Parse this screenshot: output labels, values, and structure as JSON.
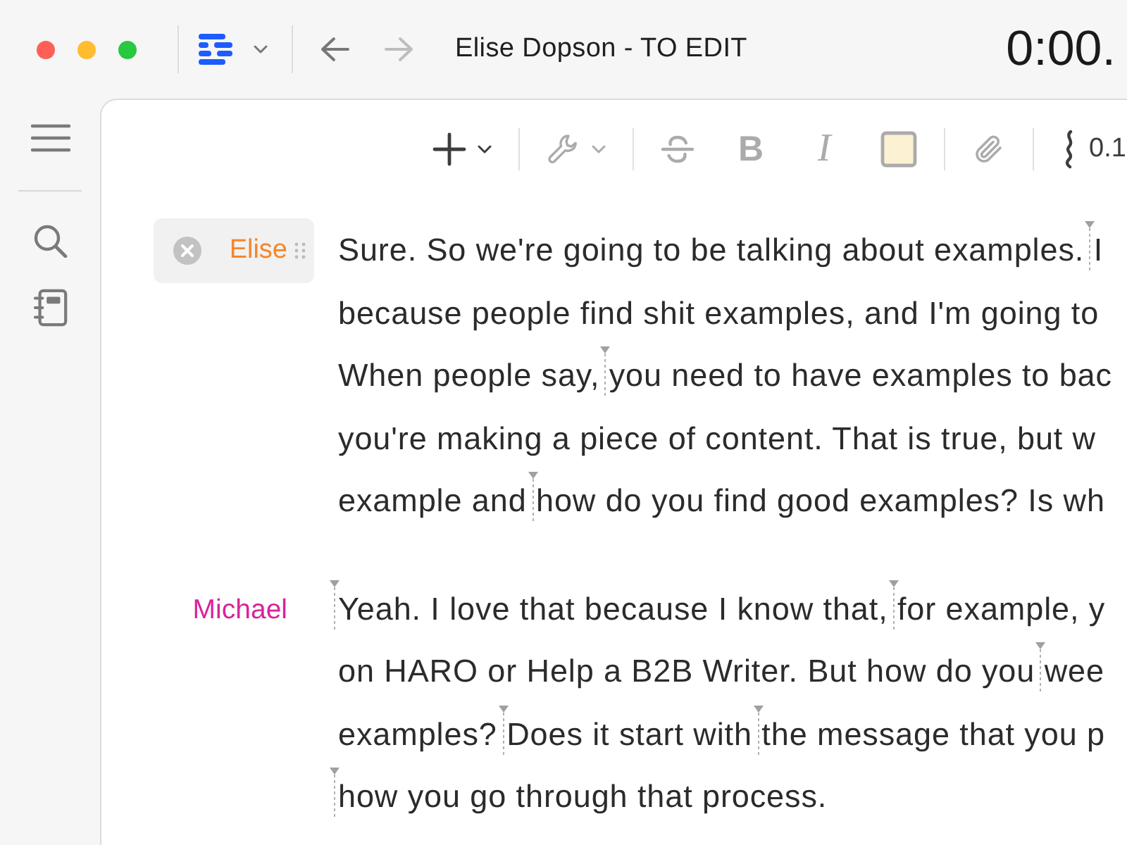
{
  "window": {
    "title": "Elise Dopson - TO EDIT",
    "timer": "0:00."
  },
  "nav": [
    {
      "kind": "back",
      "disabled": false
    },
    {
      "kind": "forward",
      "disabled": true
    }
  ],
  "sidebar": {
    "groups": [
      [
        {
          "kind": "menu"
        }
      ],
      [
        {
          "kind": "search"
        },
        {
          "kind": "notebook"
        }
      ]
    ]
  },
  "toolbar": {
    "groups": [
      [
        {
          "kind": "insert",
          "menu": true,
          "disabled": false
        }
      ],
      [
        {
          "kind": "actions",
          "menu": true,
          "disabled": true
        }
      ],
      [
        {
          "kind": "strikethrough",
          "disabled": true
        },
        {
          "kind": "bold",
          "label": "B",
          "disabled": true
        },
        {
          "kind": "italic",
          "label": "I",
          "disabled": true
        },
        {
          "kind": "highlight",
          "disabled": true
        }
      ],
      [
        {
          "kind": "attach",
          "disabled": true
        }
      ],
      [
        {
          "kind": "gap",
          "label": "0.1",
          "disabled": false
        }
      ]
    ]
  },
  "transcript": [
    {
      "speaker": "Elise",
      "color": "#f5862a",
      "selected": true,
      "lines": [
        {
          "segments": [
            {
              "text": "Sure. So we're going to be talking about examples. ",
              "marker": false
            },
            {
              "text": "I",
              "marker": true
            }
          ]
        },
        {
          "segments": [
            {
              "text": "because people find shit examples, and I'm going to",
              "marker": false
            }
          ]
        },
        {
          "segments": [
            {
              "text": "When people say, ",
              "marker": false
            },
            {
              "text": "you need to have examples to bac",
              "marker": true
            }
          ]
        },
        {
          "segments": [
            {
              "text": "you're making a piece of content. That is true, but w",
              "marker": false
            }
          ]
        },
        {
          "segments": [
            {
              "text": "example and ",
              "marker": false
            },
            {
              "text": "how do you find good examples? Is wh",
              "marker": true
            }
          ]
        }
      ]
    },
    {
      "speaker": "Michael",
      "color": "#d8239b",
      "selected": false,
      "lines": [
        {
          "segments": [
            {
              "text": "Yeah. I love that because I know that, ",
              "marker": true
            },
            {
              "text": "for example, y",
              "marker": true
            }
          ]
        },
        {
          "segments": [
            {
              "text": "on HARO or Help a B2B Writer. But how do you ",
              "marker": false
            },
            {
              "text": "wee",
              "marker": true
            }
          ]
        },
        {
          "segments": [
            {
              "text": "examples? ",
              "marker": false
            },
            {
              "text": "Does it start with ",
              "marker": true
            },
            {
              "text": "the message that you p",
              "marker": true
            }
          ]
        },
        {
          "segments": [
            {
              "text": "how you go through that process.",
              "marker": true
            }
          ]
        }
      ]
    }
  ]
}
